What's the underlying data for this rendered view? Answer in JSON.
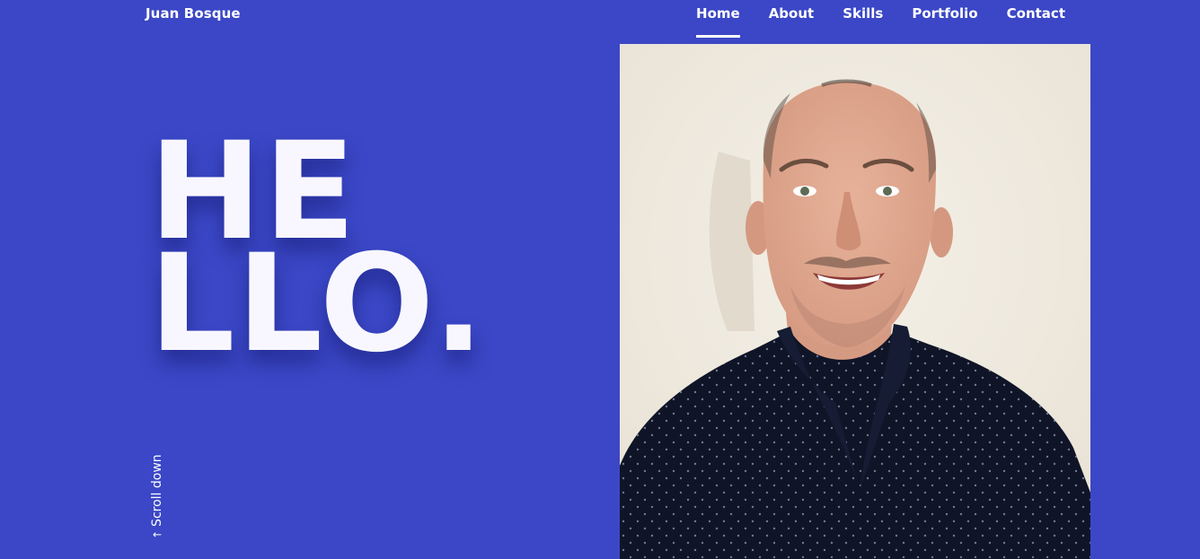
{
  "site": {
    "brand": "Juan Bosque"
  },
  "nav": {
    "items": [
      {
        "label": "Home",
        "active": true
      },
      {
        "label": "About",
        "active": false
      },
      {
        "label": "Skills",
        "active": false
      },
      {
        "label": "Portfolio",
        "active": false
      },
      {
        "label": "Contact",
        "active": false
      }
    ]
  },
  "hero": {
    "line1": "HE",
    "line2": "LLO.",
    "scroll_label": "Scroll down",
    "scroll_icon": "arrow-down-icon",
    "photo_icon": "profile-photo"
  },
  "colors": {
    "background": "#3b47c6",
    "text": "#ffffff"
  }
}
